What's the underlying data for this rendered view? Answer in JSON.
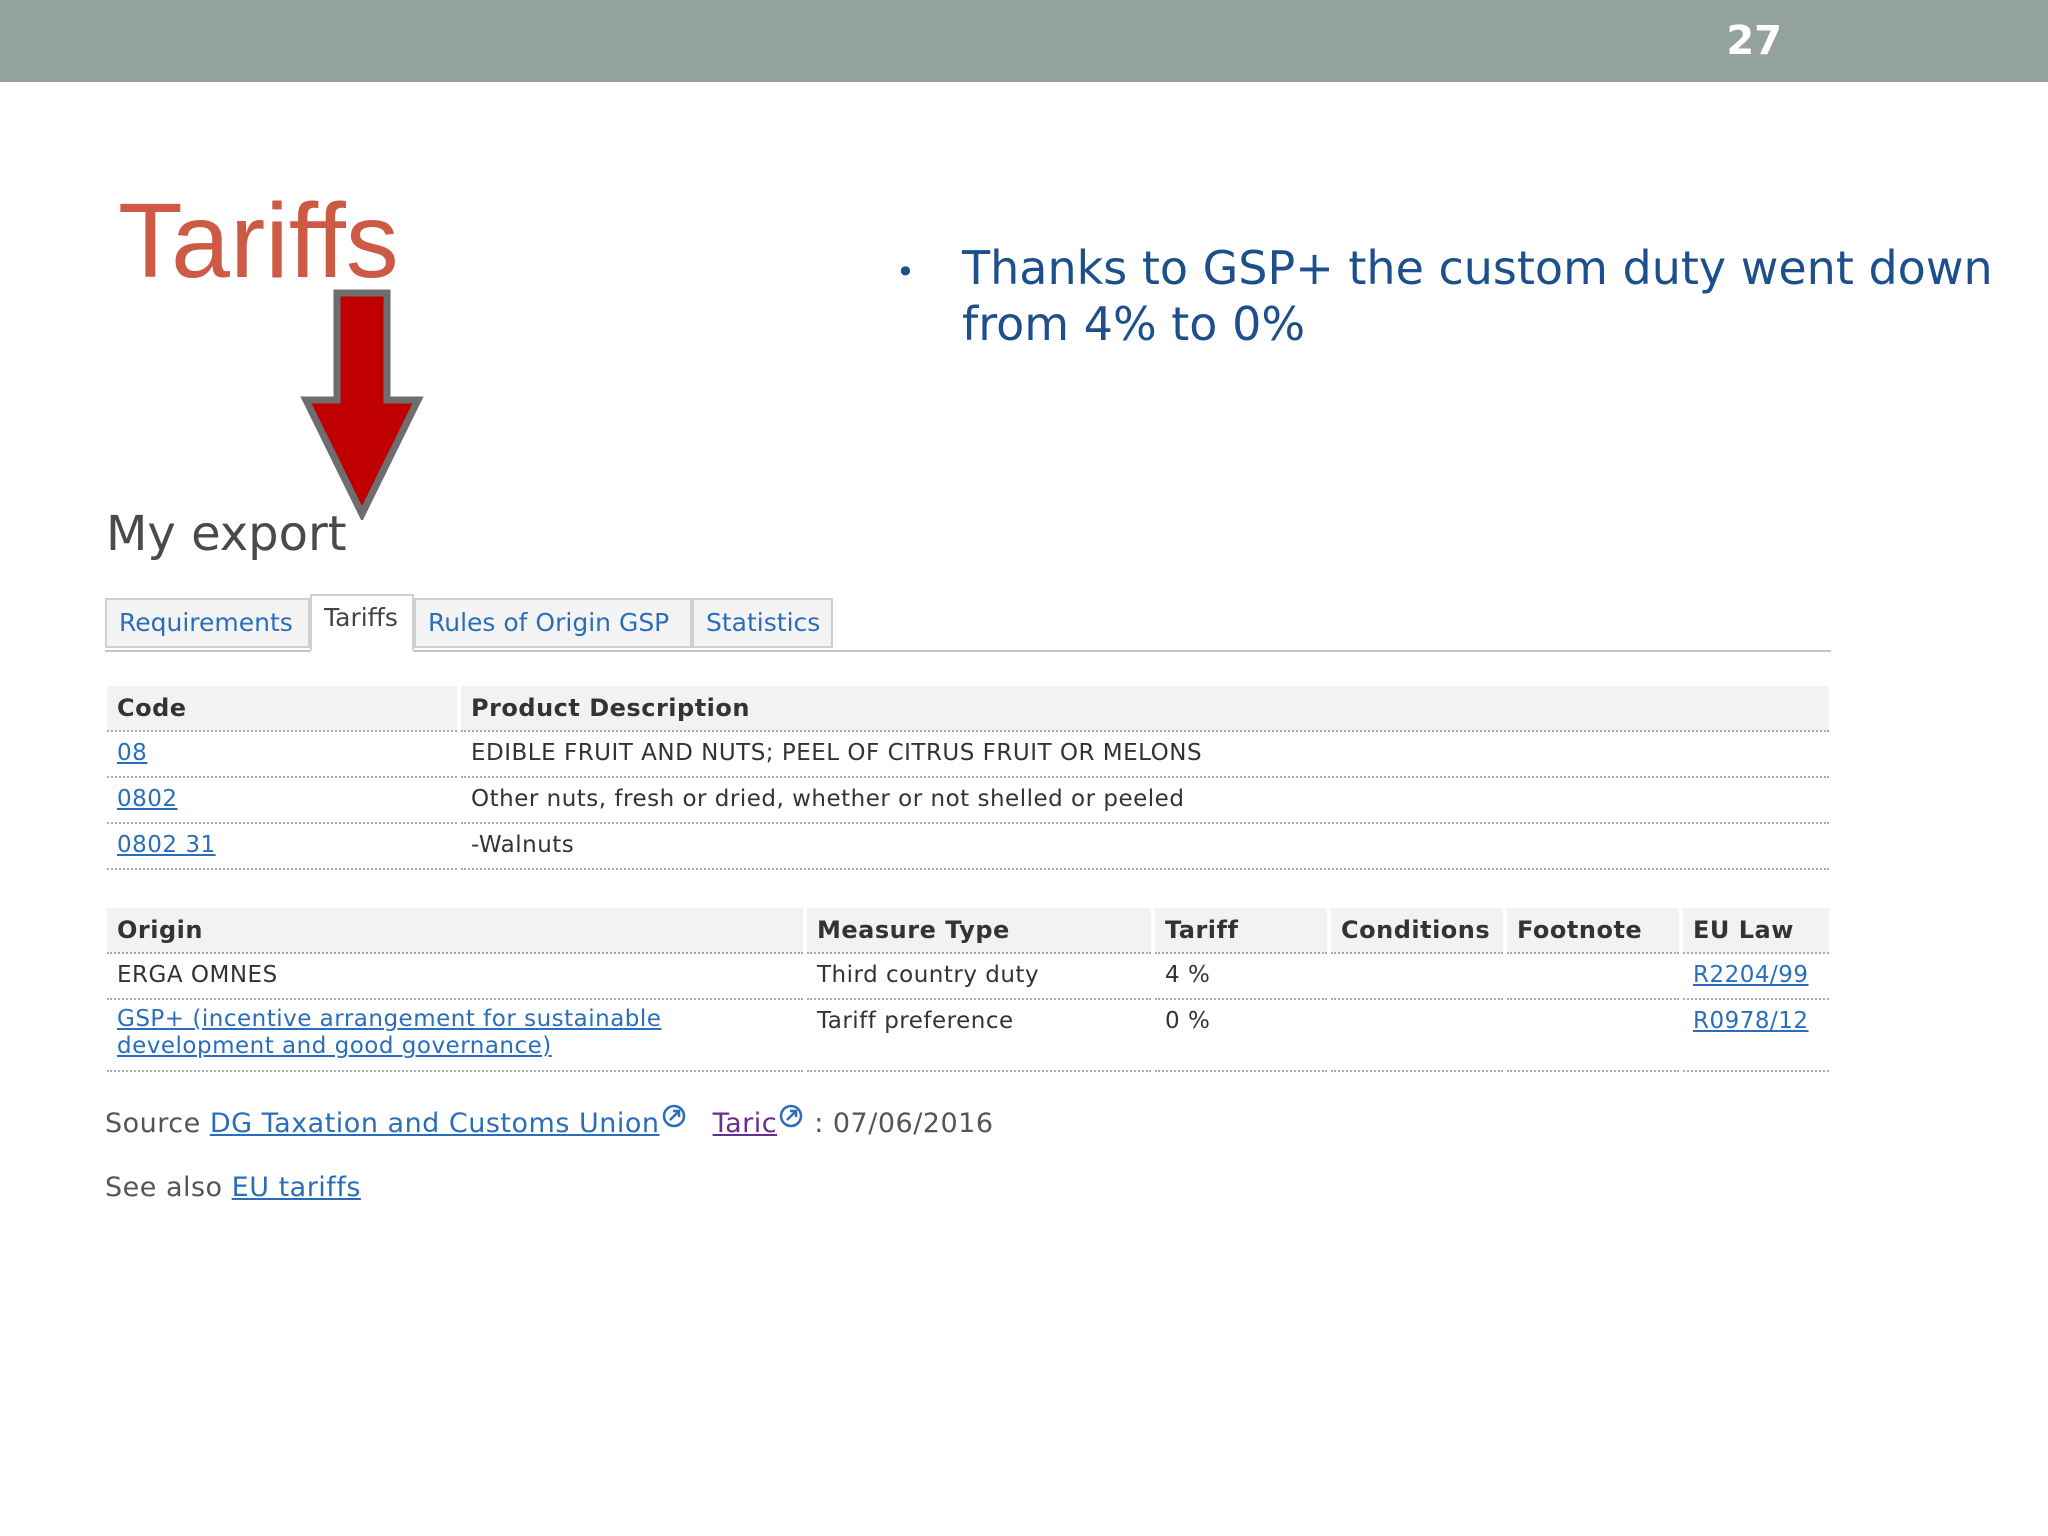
{
  "slide": {
    "page_number": "27",
    "title": "Tariffs",
    "bullet": "Thanks to GSP+ the custom duty went down from 4% to 0%"
  },
  "export": {
    "heading": "My export",
    "tabs": [
      {
        "label": "Requirements",
        "active": false
      },
      {
        "label": "Tariffs",
        "active": true
      },
      {
        "label": "Rules of Origin GSP",
        "active": false
      },
      {
        "label": "Statistics",
        "active": false
      }
    ],
    "products": {
      "headers": [
        "Code",
        "Product Description"
      ],
      "rows": [
        {
          "code": "08",
          "description": "EDIBLE FRUIT AND NUTS; PEEL OF CITRUS FRUIT OR MELONS"
        },
        {
          "code": "0802",
          "description": "Other nuts, fresh or dried, whether or not shelled or peeled"
        },
        {
          "code": "0802 31",
          "description": "-Walnuts"
        }
      ]
    },
    "measures": {
      "headers": [
        "Origin",
        "Measure Type",
        "Tariff",
        "Conditions",
        "Footnote",
        "EU Law"
      ],
      "rows": [
        {
          "origin": "ERGA OMNES",
          "origin_link": false,
          "measure_type": "Third country duty",
          "tariff": "4 %",
          "conditions": "",
          "footnote": "",
          "eu_law": "R2204/99"
        },
        {
          "origin": "GSP+ (incentive arrangement for sustainable development and good governance)",
          "origin_link": true,
          "measure_type": "Tariff preference",
          "tariff": "0 %",
          "conditions": "",
          "footnote": "",
          "eu_law": "R0978/12"
        }
      ]
    },
    "source": {
      "prefix": "Source",
      "link1": "DG Taxation and Customs Union",
      "link2": "Taric",
      "date": ": 07/06/2016"
    },
    "see_also": {
      "prefix": "See also",
      "link": "EU tariffs"
    }
  },
  "colors": {
    "title": "#cc5a45",
    "bullet": "#1d4f8c",
    "topbar": "#93a39b",
    "arrow_fill": "#c00000",
    "arrow_stroke": "#6e6e6e",
    "link": "#2a6ebb"
  }
}
